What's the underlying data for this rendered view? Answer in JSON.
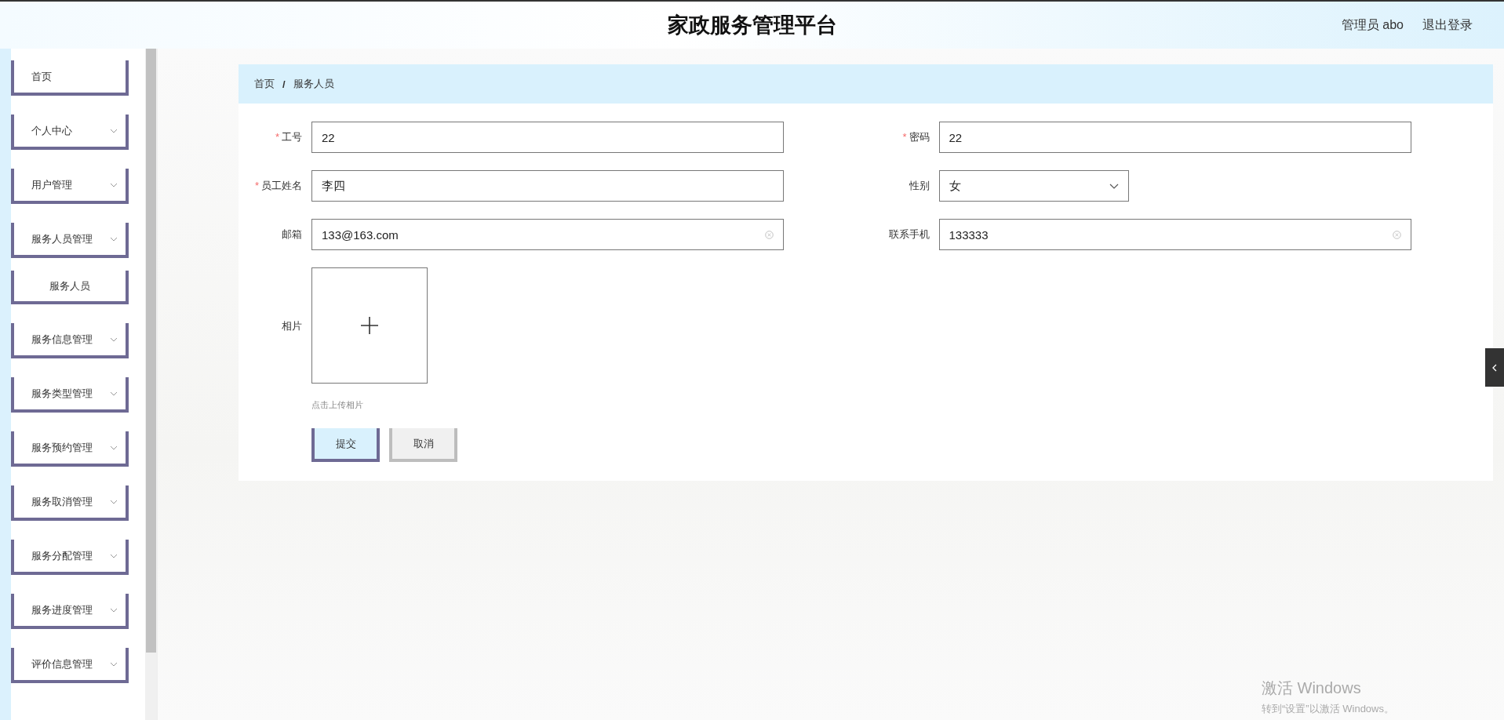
{
  "header": {
    "title": "家政服务管理平台",
    "user": "管理员 abo",
    "logout": "退出登录"
  },
  "sidebar": {
    "items": [
      {
        "label": "首页",
        "expandable": false
      },
      {
        "label": "个人中心",
        "expandable": true
      },
      {
        "label": "用户管理",
        "expandable": true
      },
      {
        "label": "服务人员管理",
        "expandable": true,
        "children": [
          {
            "label": "服务人员"
          }
        ]
      },
      {
        "label": "服务信息管理",
        "expandable": true
      },
      {
        "label": "服务类型管理",
        "expandable": true
      },
      {
        "label": "服务预约管理",
        "expandable": true
      },
      {
        "label": "服务取消管理",
        "expandable": true
      },
      {
        "label": "服务分配管理",
        "expandable": true
      },
      {
        "label": "服务进度管理",
        "expandable": true
      },
      {
        "label": "评价信息管理",
        "expandable": true
      }
    ]
  },
  "breadcrumb": {
    "separator": "/",
    "items": [
      "首页",
      "服务人员"
    ]
  },
  "form": {
    "required_mark": "*",
    "fields": [
      {
        "kind": "text",
        "label": "工号",
        "required": true,
        "value": "22",
        "clearable": false
      },
      {
        "kind": "text",
        "label": "密码",
        "required": true,
        "value": "22",
        "clearable": false
      },
      {
        "kind": "text",
        "label": "员工姓名",
        "required": true,
        "value": "李四",
        "clearable": false
      },
      {
        "kind": "select",
        "label": "性别",
        "required": false,
        "value": "女"
      },
      {
        "kind": "text",
        "label": "邮箱",
        "required": false,
        "value": "133@163.com",
        "clearable": true
      },
      {
        "kind": "text",
        "label": "联系手机",
        "required": false,
        "value": "133333",
        "clearable": true
      },
      {
        "kind": "upload",
        "label": "相片",
        "required": false,
        "hint": "点击上传相片"
      }
    ],
    "buttons": [
      {
        "label": "提交",
        "kind": "primary"
      },
      {
        "label": "取消",
        "kind": "default"
      }
    ]
  },
  "os_notice": {
    "title": "激活 Windows",
    "text": "转到“设置”以激活 Windows。"
  }
}
